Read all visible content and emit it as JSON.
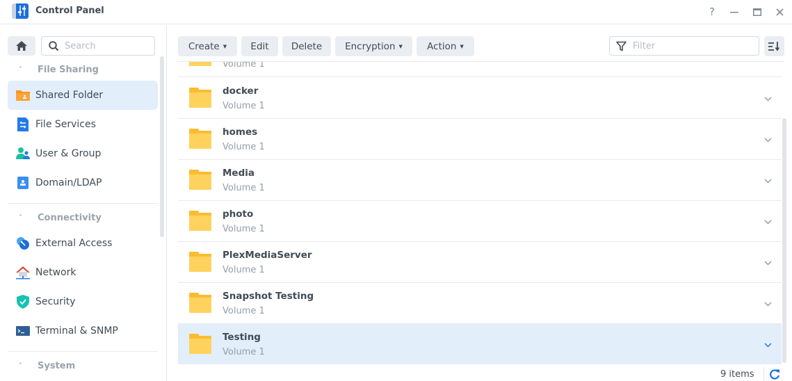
{
  "window": {
    "title": "Control Panel",
    "icons": {
      "app": "control-panel-icon",
      "help": "help-icon",
      "minimize": "minimize-icon",
      "maximize": "maximize-icon",
      "close": "close-icon"
    },
    "help_glyph": "?",
    "close_glyph": "✕"
  },
  "sidebar": {
    "search_placeholder": "Search",
    "groups": [
      {
        "label": "File Sharing",
        "items": [
          {
            "label": "Shared Folder",
            "icon": "shared-folder-icon",
            "active": true
          },
          {
            "label": "File Services",
            "icon": "file-services-icon"
          },
          {
            "label": "User & Group",
            "icon": "user-group-icon"
          },
          {
            "label": "Domain/LDAP",
            "icon": "domain-ldap-icon"
          }
        ]
      },
      {
        "label": "Connectivity",
        "items": [
          {
            "label": "External Access",
            "icon": "external-access-icon"
          },
          {
            "label": "Network",
            "icon": "network-icon"
          },
          {
            "label": "Security",
            "icon": "security-icon"
          },
          {
            "label": "Terminal & SNMP",
            "icon": "terminal-icon"
          }
        ]
      },
      {
        "label": "System",
        "items": []
      }
    ]
  },
  "toolbar": {
    "create": "Create",
    "edit": "Edit",
    "delete": "Delete",
    "encryption": "Encryption",
    "action": "Action",
    "filter_placeholder": "Filter"
  },
  "folders": [
    {
      "name": "",
      "location": "Volume 1",
      "partial": true
    },
    {
      "name": "docker",
      "location": "Volume 1"
    },
    {
      "name": "homes",
      "location": "Volume 1"
    },
    {
      "name": "Media",
      "location": "Volume 1"
    },
    {
      "name": "photo",
      "location": "Volume 1"
    },
    {
      "name": "PlexMediaServer",
      "location": "Volume 1"
    },
    {
      "name": "Snapshot Testing",
      "location": "Volume 1"
    },
    {
      "name": "Testing",
      "location": "Volume 1",
      "selected": true
    }
  ],
  "footer": {
    "count": "9 items"
  },
  "colors": {
    "accent": "#1c6fd8",
    "selected_bg": "#e3eefb",
    "folder": "#ffd25e"
  }
}
